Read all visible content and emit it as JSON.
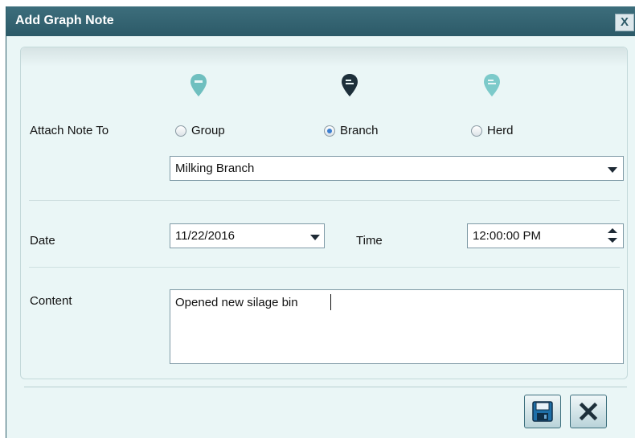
{
  "window": {
    "title": "Add Graph Note",
    "close_glyph": "X"
  },
  "attach": {
    "label": "Attach Note To",
    "options": [
      {
        "label": "Group",
        "checked": false,
        "pin_color": "#6fbfbf"
      },
      {
        "label": "Branch",
        "checked": true,
        "pin_color": "#1d2f3a"
      },
      {
        "label": "Herd",
        "checked": false,
        "pin_color": "#7ccaca"
      }
    ],
    "selected_value": "Milking Branch"
  },
  "date": {
    "label": "Date",
    "value": "11/22/2016"
  },
  "time": {
    "label": "Time",
    "value": "12:00:00 PM"
  },
  "content": {
    "label": "Content",
    "value": "Opened new silage bin"
  },
  "footer": {
    "save_icon": "floppy-disk-icon",
    "cancel_icon": "close-icon",
    "accent_color": "#2c5a68"
  }
}
